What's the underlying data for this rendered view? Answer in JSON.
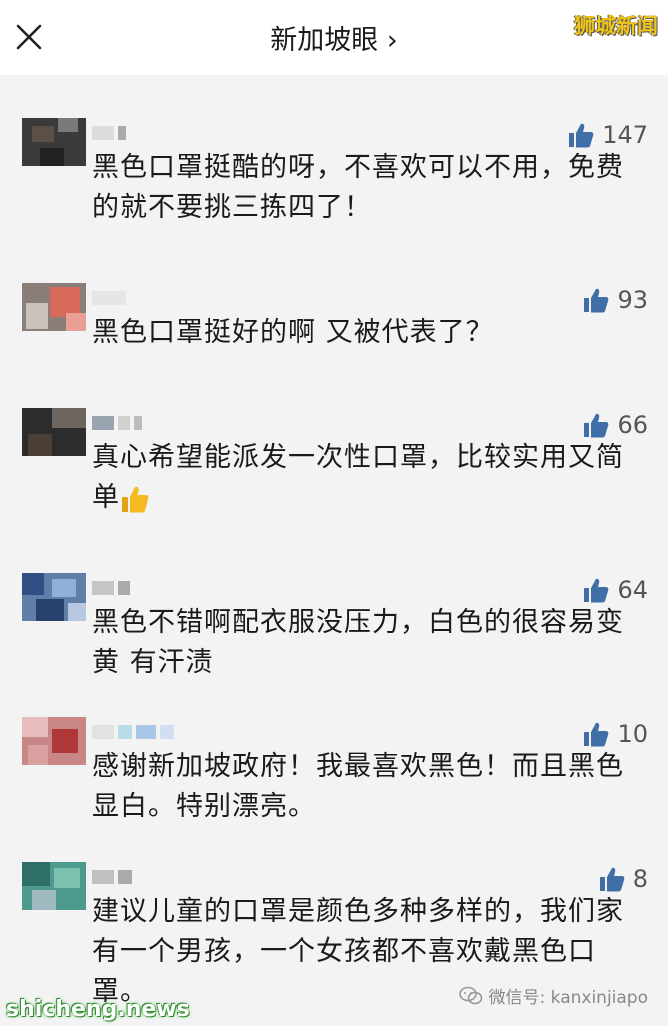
{
  "header": {
    "title": "新加坡眼 ›",
    "watermark": "狮城新闻"
  },
  "comments": [
    {
      "likes": "147",
      "text": "黑色口罩挺酷的呀，不喜欢可以不用，免费的就不要挑三拣四了！"
    },
    {
      "likes": "93",
      "text": "黑色口罩挺好的啊 又被代表了？"
    },
    {
      "likes": "66",
      "text": "真心希望能派发一次性口罩，比较实用又简单",
      "emoji": "thumbs-up-emoji"
    },
    {
      "likes": "64",
      "text": "黑色不错啊配衣服没压力，白色的很容易变黄 有汗渍"
    },
    {
      "likes": "10",
      "text": "感谢新加坡政府！我最喜欢黑色！而且黑色显白。特别漂亮。"
    },
    {
      "likes": "8",
      "text": "建议儿童的口罩是颜色多种多样的，我们家有一个男孩，一个女孩都不喜欢戴黑色口罩。"
    }
  ],
  "footer": {
    "watermark": "shicheng.news",
    "wechat": "微信号: kanxinjiapo"
  },
  "colors": {
    "thumb": "#3f6fa6",
    "emoji": "#f5b921"
  },
  "icons": [
    "close-icon",
    "thumbs-up-icon",
    "wechat-icon"
  ]
}
